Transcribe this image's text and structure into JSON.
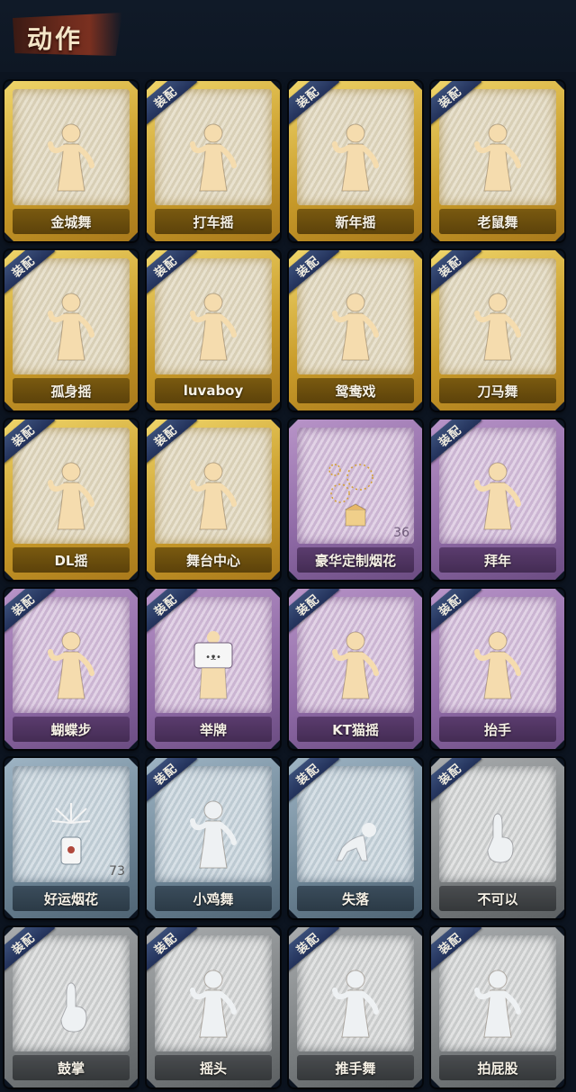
{
  "header": {
    "title": "动作"
  },
  "badge_label": "装配",
  "colors": {
    "gold": "#c99c2a",
    "purple": "#8f6aa6",
    "blue": "#6f8798",
    "grey": "#7e8284",
    "badge": "#2c3d68"
  },
  "items": [
    {
      "name": "金城舞",
      "tier": "gold",
      "equipped": false,
      "icon": "dance-figure-icon",
      "count": ""
    },
    {
      "name": "打车摇",
      "tier": "gold",
      "equipped": true,
      "icon": "dance-figure-icon",
      "count": ""
    },
    {
      "name": "新年摇",
      "tier": "gold",
      "equipped": true,
      "icon": "dance-figure-icon",
      "count": ""
    },
    {
      "name": "老鼠舞",
      "tier": "gold",
      "equipped": true,
      "icon": "dance-figure-icon",
      "count": ""
    },
    {
      "name": "孤身摇",
      "tier": "gold",
      "equipped": true,
      "icon": "dance-figure-icon",
      "count": ""
    },
    {
      "name": "luvaboy",
      "tier": "gold",
      "equipped": true,
      "icon": "dance-figure-icon",
      "count": ""
    },
    {
      "name": "鸳鸯戏",
      "tier": "gold",
      "equipped": true,
      "icon": "dance-figure-icon",
      "count": ""
    },
    {
      "name": "刀马舞",
      "tier": "gold",
      "equipped": true,
      "icon": "dance-figure-icon",
      "count": ""
    },
    {
      "name": "DL摇",
      "tier": "gold",
      "equipped": true,
      "icon": "dance-figure-icon",
      "count": ""
    },
    {
      "name": "舞台中心",
      "tier": "gold",
      "equipped": true,
      "icon": "dance-figure-icon",
      "count": ""
    },
    {
      "name": "豪华定制烟花",
      "tier": "purple",
      "equipped": false,
      "icon": "fireworks-box-icon",
      "count": "36"
    },
    {
      "name": "拜年",
      "tier": "purple",
      "equipped": true,
      "icon": "bow-figure-icon",
      "count": ""
    },
    {
      "name": "蝴蝶步",
      "tier": "purple",
      "equipped": true,
      "icon": "dance-figure-icon",
      "count": ""
    },
    {
      "name": "举牌",
      "tier": "purple",
      "equipped": true,
      "icon": "sign-figure-icon",
      "count": ""
    },
    {
      "name": "KT猫摇",
      "tier": "purple",
      "equipped": true,
      "icon": "dance-figure-icon",
      "count": ""
    },
    {
      "name": "抬手",
      "tier": "purple",
      "equipped": true,
      "icon": "raise-hand-figure-icon",
      "count": ""
    },
    {
      "name": "好运烟花",
      "tier": "blue",
      "equipped": false,
      "icon": "firework-can-icon",
      "count": "73"
    },
    {
      "name": "小鸡舞",
      "tier": "blue",
      "equipped": true,
      "icon": "chicken-dance-figure-icon",
      "count": ""
    },
    {
      "name": "失落",
      "tier": "blue",
      "equipped": true,
      "icon": "crawl-figure-icon",
      "count": ""
    },
    {
      "name": "不可以",
      "tier": "grey",
      "equipped": true,
      "icon": "finger-wag-icon",
      "count": ""
    },
    {
      "name": "鼓掌",
      "tier": "grey",
      "equipped": true,
      "icon": "clap-hands-icon",
      "count": ""
    },
    {
      "name": "摇头",
      "tier": "grey",
      "equipped": true,
      "icon": "shake-head-figure-icon",
      "count": ""
    },
    {
      "name": "推手舞",
      "tier": "grey",
      "equipped": true,
      "icon": "push-dance-figure-icon",
      "count": ""
    },
    {
      "name": "拍屁股",
      "tier": "grey",
      "equipped": true,
      "icon": "butt-slap-figure-icon",
      "count": ""
    }
  ]
}
